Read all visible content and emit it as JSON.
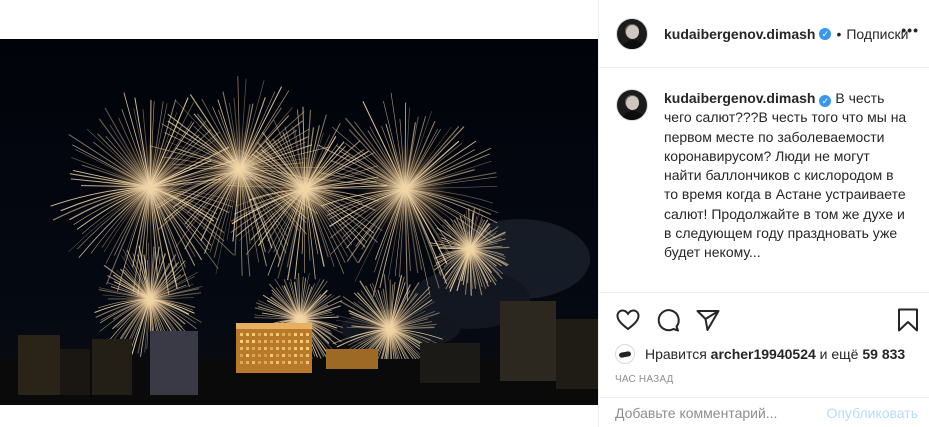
{
  "post": {
    "username": "kudaibergenov.dimash",
    "verified_glyph": "✓",
    "separator": "•",
    "follow_label": "Подписки",
    "more_label": "•••"
  },
  "caption": {
    "username": "kudaibergenov.dimash",
    "text": "В честь чего салют???В честь того что мы на первом месте по заболеваемости коронавирусом? Люди не могут найти баллончиков с кислородом в то время когда в Астане устраиваете салют! Продолжайте в том же духе и в следующем году праздновать уже будет некому..."
  },
  "icons": {
    "like": "heart-icon",
    "comment": "comment-icon",
    "share": "send-icon",
    "save": "bookmark-icon"
  },
  "likes": {
    "prefix": "Нравится",
    "user": "archer19940524",
    "middle": "и ещё",
    "count": "59 833"
  },
  "time_label": "ЧАС НАЗАД",
  "comment_box": {
    "placeholder": "Добавьте комментарий...",
    "publish_label": "Опубликовать"
  },
  "colors": {
    "verified": "#3897f0",
    "publish_disabled": "#b2dffc",
    "firework": "#f3d6a6"
  }
}
